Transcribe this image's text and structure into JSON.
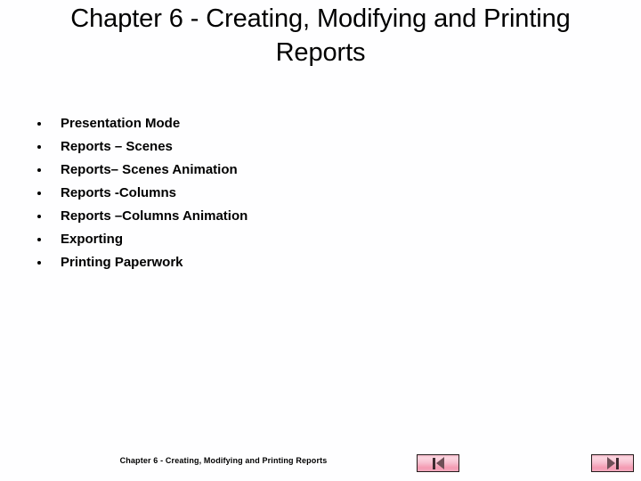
{
  "slide": {
    "title": "Chapter 6 - Creating, Modifying and Printing\nReports",
    "background_color": "#fefeff",
    "text_color": "#000000",
    "bullets": [
      {
        "label": "Presentation Mode"
      },
      {
        "label": "Reports – Scenes"
      },
      {
        "label": "Reports– Scenes Animation"
      },
      {
        "label": "Reports -Columns"
      },
      {
        "label": "Reports –Columns Animation"
      },
      {
        "label": "Exporting"
      },
      {
        "label": "Printing Paperwork"
      }
    ],
    "footer": {
      "text": "Chapter 6 - Creating, Modifying and Printing Reports"
    },
    "navigation": {
      "previous": {
        "icon": "first-slide-icon",
        "accent_color": "#f4aac0",
        "border_color": "#241c1c",
        "glyph_color": "#6d4f57"
      },
      "next": {
        "icon": "last-slide-icon",
        "accent_color": "#f4aac0",
        "border_color": "#241c1c",
        "glyph_color": "#6d4f57"
      }
    }
  }
}
